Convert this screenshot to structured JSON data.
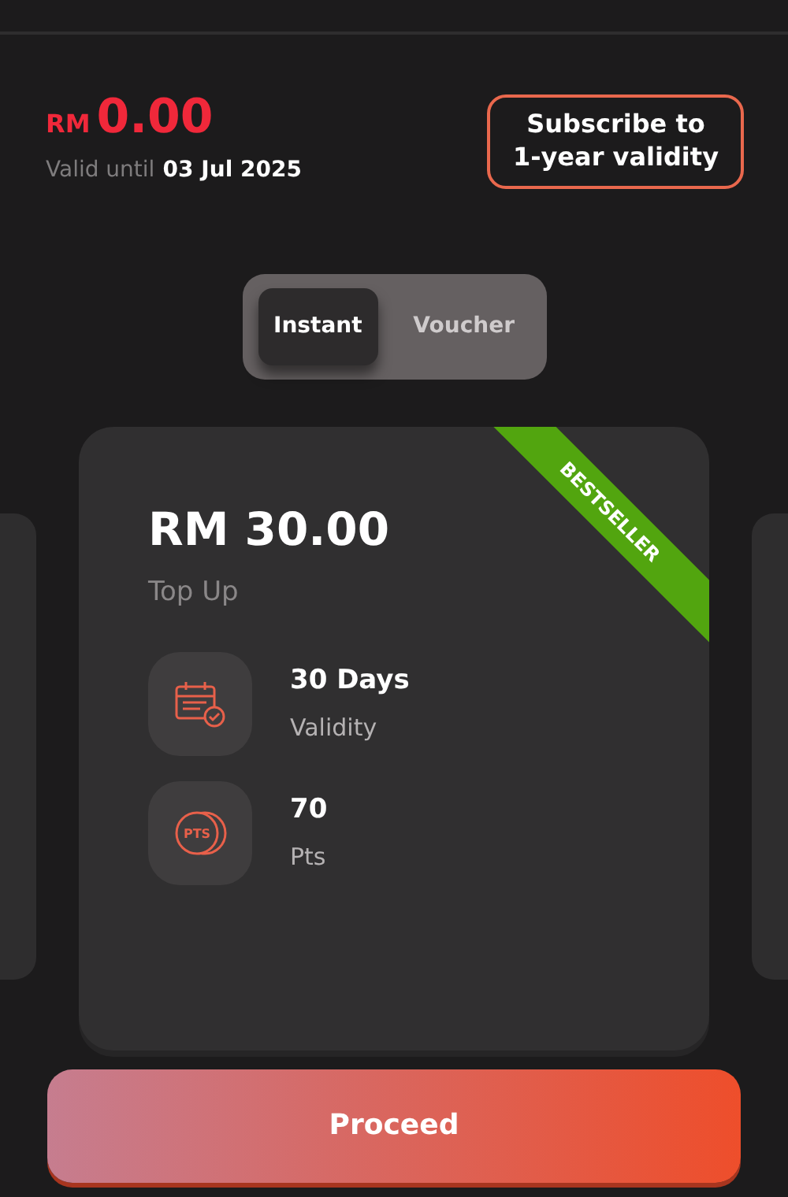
{
  "balance": {
    "currency": "RM",
    "amount": "0.00",
    "valid_label": "Valid until",
    "valid_date": "03 Jul 2025"
  },
  "subscribe_button": {
    "lines": [
      "Subscribe to",
      "1-year validity"
    ]
  },
  "tabs": [
    {
      "label": "Instant",
      "selected": true
    },
    {
      "label": "Voucher",
      "selected": false
    }
  ],
  "plan": {
    "price": "RM 30.00",
    "type": "Top Up",
    "ribbon": "BESTSELLER",
    "features": [
      {
        "kind": "calendar",
        "value": "30 Days",
        "label": "Validity"
      },
      {
        "kind": "points",
        "icon_text": "PTS",
        "value": "70",
        "label": "Pts"
      }
    ]
  },
  "proceed_button": "Proceed"
}
